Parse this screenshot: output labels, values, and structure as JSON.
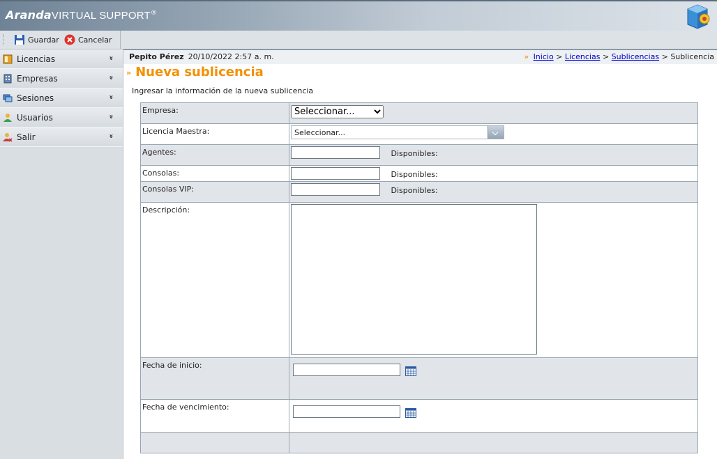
{
  "header": {
    "brand_bold": "Aranda",
    "brand_rest": "VIRTUAL SUPPORT",
    "brand_mark": "®",
    "icon": "app-cube-icon"
  },
  "toolbar": {
    "save_label": "Guardar",
    "cancel_label": "Cancelar",
    "save_icon": "floppy-disk-icon",
    "cancel_icon": "red-x-circle-icon"
  },
  "sidebar": {
    "items": [
      {
        "label": "Licencias",
        "icon": "license-icon"
      },
      {
        "label": "Empresas",
        "icon": "building-icon"
      },
      {
        "label": "Sesiones",
        "icon": "sessions-icon"
      },
      {
        "label": "Usuarios",
        "icon": "user-icon"
      },
      {
        "label": "Salir",
        "icon": "exit-icon"
      }
    ],
    "chevron": "»"
  },
  "userbar": {
    "user_name": "Pepito Pérez",
    "datetime": "20/10/2022 2:57 a. m."
  },
  "breadcrumb": {
    "raquo": "»",
    "items": [
      "Inicio",
      "Licencias",
      "Sublicencias"
    ],
    "current": "Sublicencia",
    "separator": ">"
  },
  "page": {
    "title_marker": "»",
    "title": "Nueva sublicencia",
    "subtitle": "Ingresar la información de la nueva sublicencia"
  },
  "form": {
    "empresa_label": "Empresa:",
    "empresa_value": "Seleccionar...",
    "licencia_label": "Licencia Maestra:",
    "licencia_value": "Seleccionar...",
    "agentes_label": "Agentes:",
    "consolas_label": "Consolas:",
    "consolas_vip_label": "Consolas VIP:",
    "disponibles_label": "Disponibles:",
    "descripcion_label": "Descripción:",
    "fecha_inicio_label": "Fecha de inicio:",
    "fecha_venc_label": "Fecha de vencimiento:",
    "calendar_icon": "calendar-icon"
  }
}
